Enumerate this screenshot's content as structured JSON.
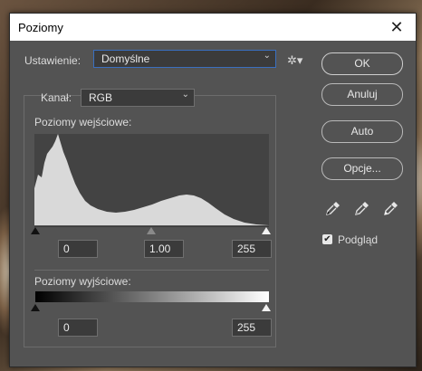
{
  "window": {
    "title": "Poziomy"
  },
  "preset": {
    "label": "Ustawienie:",
    "value": "Domyślne"
  },
  "channel": {
    "label": "Kanał:",
    "value": "RGB"
  },
  "input_levels": {
    "label": "Poziomy wejściowe:",
    "black": "0",
    "gamma": "1.00",
    "white": "255"
  },
  "output_levels": {
    "label": "Poziomy wyjściowe:",
    "black": "0",
    "white": "255"
  },
  "buttons": {
    "ok": "OK",
    "cancel": "Anuluj",
    "auto": "Auto",
    "options": "Opcje..."
  },
  "preview": {
    "label": "Podgląd",
    "checked": true
  },
  "icons": {
    "close": "close-icon",
    "gear": "gear-icon",
    "eyedroppers": [
      "black-eyedropper-icon",
      "gray-eyedropper-icon",
      "white-eyedropper-icon"
    ]
  },
  "colors": {
    "dialog_bg": "#535353",
    "focus_border": "#3a6fbf",
    "histogram_fill": "#d9d9d9"
  }
}
